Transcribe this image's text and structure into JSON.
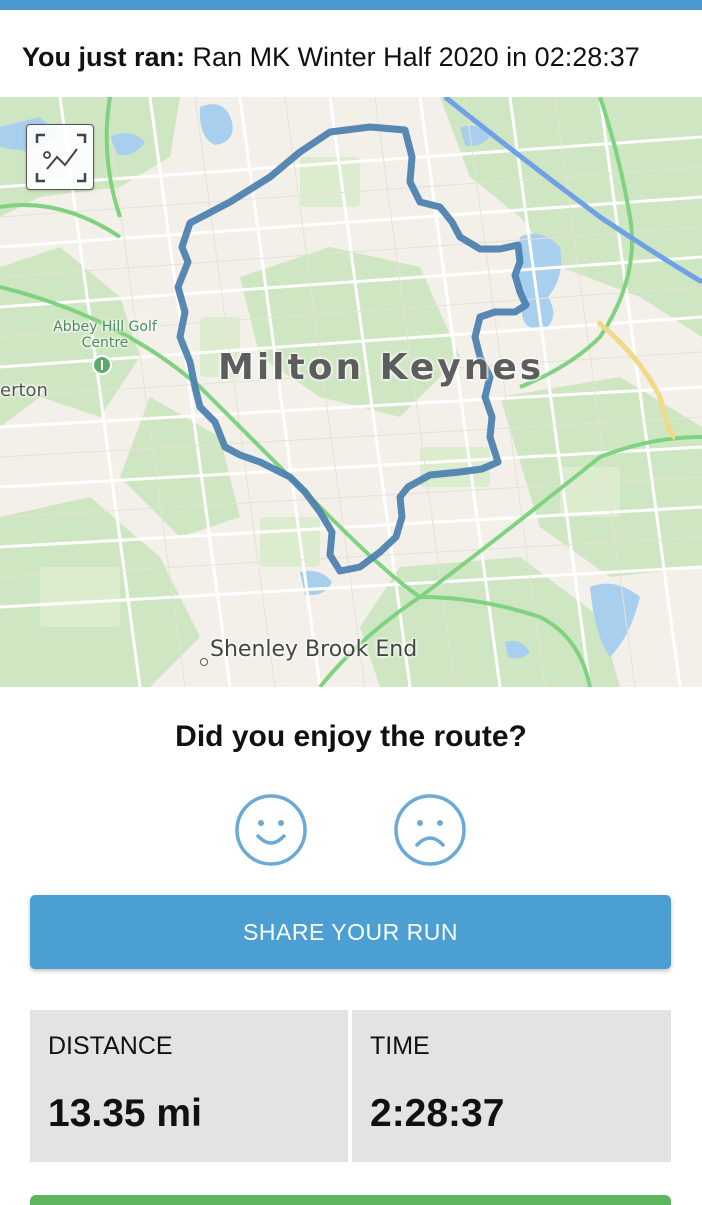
{
  "header": {
    "prefix": "You just ran:",
    "text": "Ran MK Winter Half 2020 in 02:28:37"
  },
  "map": {
    "city_label": "Milton Keynes",
    "golf_label": "Abbey Hill Golf Centre",
    "partial_label": "erton",
    "place_label": "Shenley Brook End",
    "expand_icon": "map-expand-icon",
    "route_color": "#4a7fae"
  },
  "feedback": {
    "question": "Did you enjoy the route?",
    "positive_icon": "smiley-face-icon",
    "negative_icon": "sad-face-icon"
  },
  "share": {
    "label": "SHARE YOUR RUN",
    "color": "#4c9fd3"
  },
  "stats": {
    "distance_label": "DISTANCE",
    "distance_value": "13.35 mi",
    "time_label": "TIME",
    "time_value": "2:28:37"
  },
  "colors": {
    "accent": "#4a9ad1",
    "face_outline": "#6ba9d6",
    "stat_bg": "#e3e3e3"
  }
}
